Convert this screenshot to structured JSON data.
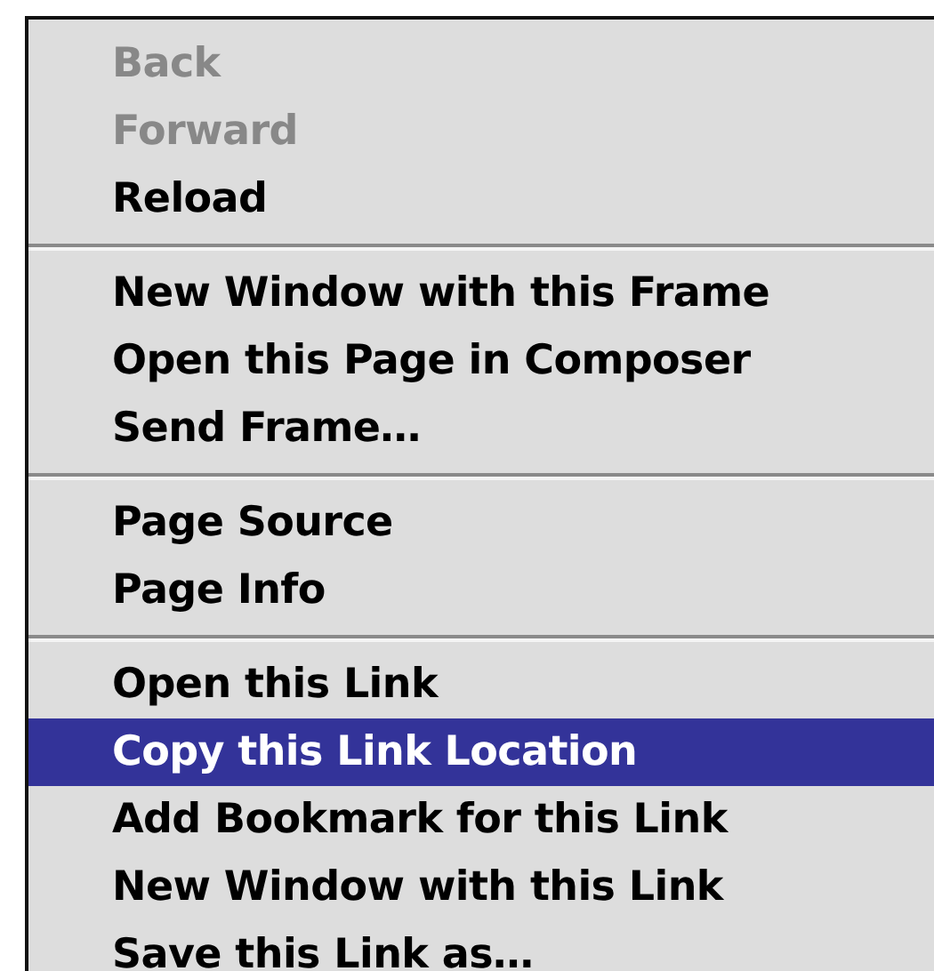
{
  "context_menu": {
    "groups": [
      {
        "items": [
          {
            "label": "Back",
            "disabled": true,
            "selected": false
          },
          {
            "label": "Forward",
            "disabled": true,
            "selected": false
          },
          {
            "label": "Reload",
            "disabled": false,
            "selected": false
          }
        ]
      },
      {
        "items": [
          {
            "label": "New Window with this Frame",
            "disabled": false,
            "selected": false
          },
          {
            "label": "Open this Page in Composer",
            "disabled": false,
            "selected": false
          },
          {
            "label": "Send Frame…",
            "disabled": false,
            "selected": false
          }
        ]
      },
      {
        "items": [
          {
            "label": "Page Source",
            "disabled": false,
            "selected": false
          },
          {
            "label": "Page Info",
            "disabled": false,
            "selected": false
          }
        ]
      },
      {
        "items": [
          {
            "label": "Open this Link",
            "disabled": false,
            "selected": false
          },
          {
            "label": "Copy this Link Location",
            "disabled": false,
            "selected": true
          },
          {
            "label": "Add Bookmark for this Link",
            "disabled": false,
            "selected": false
          },
          {
            "label": "New Window with this Link",
            "disabled": false,
            "selected": false
          },
          {
            "label": "Save this Link as…",
            "disabled": false,
            "selected": false
          }
        ]
      }
    ]
  }
}
